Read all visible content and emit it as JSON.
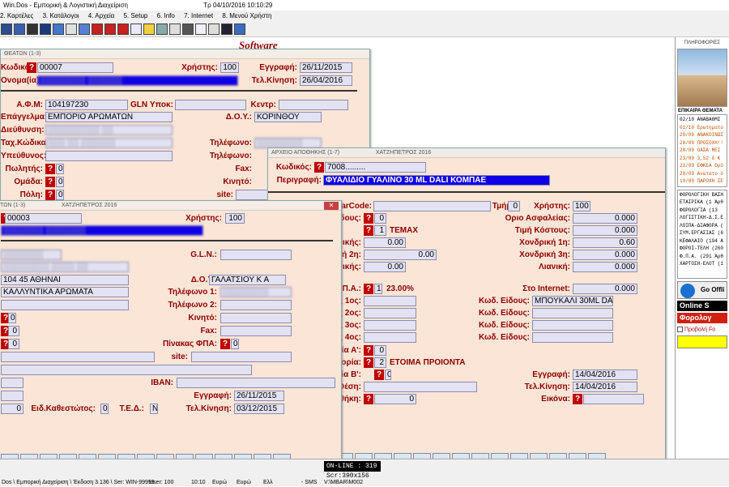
{
  "app": {
    "title": "Win.Dos - Εμπορική & Λογιστική Διαχείριση",
    "date": "Τρ 04/10/2016 10:10:29"
  },
  "menu": [
    "2. Καρτέλες",
    "3. Κατάλογοι",
    "4. Αρχεία",
    "5. Setup",
    "6. Info",
    "7. Internet",
    "8. Μενού Χρήστη"
  ],
  "brand": "Software",
  "w1": {
    "title": "ΘΕΑΤΩΝ (1-3)",
    "kod_lbl": "Κωδικός:",
    "kod": "00007",
    "xrhsths_lbl": "Χρήστης:",
    "xrhsths": "100",
    "eggrafh_lbl": "Εγγραφή:",
    "eggrafh": "26/11/2015",
    "onoma_lbl": "Ονομα(ία):",
    "telkin_lbl": "Τελ.Κίνηση:",
    "telkin": "26/04/2016",
    "afm_lbl": "Α.Φ.Μ:",
    "afm": "104197230",
    "gln_lbl": "GLN Υποκ:",
    "kentr_lbl": "Κεντρ:",
    "epag_lbl": "Επάγγελμα:",
    "epag": "ΕΜΠΟΡΙΟ ΑΡΩΜΑΤΩΝ",
    "doy_lbl": "Δ.Ο.Υ.:",
    "doy": "ΚΟΡΙΝΘΟΥ",
    "dieu_lbl": "Διεύθυνση:",
    "tk_lbl": "Ταχ.Κώδικας:",
    "til_lbl": "Τηλέφωνο:",
    "ypeu_lbl": "Υπεύθυνος:",
    "til2_lbl": "Τηλέφωνο:",
    "pol_lbl": "Πωλητής:",
    "pol": "0",
    "fax_lbl": "Fax:",
    "omada_lbl": "Ομάδα:",
    "omada": "0",
    "kin_lbl": "Κινητό:",
    "poli_lbl": "Πόλη:",
    "poli": "0",
    "site_lbl": "site:"
  },
  "w2": {
    "title": "ΤΩΝ (1-3)",
    "title2": "ΧΑΤΖΗΠΕΤΡΟΣ 2016",
    "kod": "00003",
    "xrhsths_lbl": "Χρήστης:",
    "xrhsths": "100",
    "gln_lbl": "G.L.N.:",
    "afm": "104 45  ΑΘΗΝΑΙ",
    "doy_lbl": "Δ.Ο.Υ.:",
    "doy": "ΓΑΛΑΤΣΙΟΥ Κ Α",
    "epag": "ΚΑΛΛΥΝΤΙΚΑ ΑΡΩΜΑΤΑ",
    "til1_lbl": "Τηλέφωνο 1:",
    "til2_lbl": "Τηλέφωνο 2:",
    "kin_lbl": "Κινητό:",
    "v0a": "0",
    "v0b": "0",
    "fax_lbl": "Fax:",
    "v0c": "0",
    "fpa_lbl": "Πίνακας ΦΠΑ:",
    "fpa": "0",
    "site_lbl": "site:",
    "iban_lbl": "IBAN:",
    "eggrafh_lbl": "Εγγραφή:",
    "eggrafh": "26/11/2015",
    "eidk_lbl": "Ειδ.Καθεστώτος:",
    "eidk": "0",
    "ted_lbl": "Τ.Ε.Δ.:",
    "ted": "N",
    "telkin_lbl": "Τελ.Κίνηση:",
    "telkin": "03/12/2015",
    "v0d": "0"
  },
  "w3": {
    "title": "ΑΡΧΕΙΟ ΑΠΟΘΗΚΗΣ   (1-7)",
    "title2": "ΧΑΤΖΗΠΕΤΡΟΣ 2016",
    "kod_lbl": "Κωδικός:",
    "kod": "7008.........",
    "perig_lbl": "Περιγραφή:",
    "perig": "ΦΥΑΛΙΔΙΟ ΓΥΑΛΙΝΟ 30 ML DALI  ΚΟΜΠΑΕ",
    "barcode_lbl": "BarCode:",
    "tmhma_lbl": "Τμήμα:",
    "tmhma": "0",
    "xrhsths_lbl": "Χρήστης:",
    "xrhsths": "100",
    "eidous_lbl": "ίδους:",
    "eidous": "0",
    "orio_lbl": "Οριο Ασφαλείας:",
    "orio": "0.000",
    "mon_val": "1",
    "mon": "TEMAX",
    "timi_lbl": "Τιμή Κόστους:",
    "timi": "0.000",
    "xondr_lbl": "ονδρικής:",
    "xondr": "0.00",
    "x1_lbl": "Χονδρική 1η:",
    "x1": "0.60",
    "x2_lbl": "δρική 2η:",
    "x2": "0.00",
    "x3_lbl": "Χονδρική 3η:",
    "x3": "0.000",
    "lian_lbl": "ιανικής:",
    "lian": "0.00",
    "lianiki_lbl": "Λιανική:",
    "lianiki": "0.000",
    "fpa_lbl": "Π.Α.:",
    "fpa_val": "1",
    "fpa_pct": "23.00%",
    "internet_lbl": "Στο Internet:",
    "internet": "0.000",
    "e1_lbl": "Κωδ. Είδους:",
    "e1": "ΜΠΟΥΚΑΛΙ 30ML DALI",
    "e2_lbl": "Κωδ. Είδους:",
    "e3_lbl": "Κωδ. Είδους:",
    "e4_lbl": "Κωδ. Είδους:",
    "c1_lbl": "ς 1ος:",
    "c2_lbl": "ς 2ος:",
    "c3_lbl": "ς 3ος:",
    "c4_lbl": "ς 4ος:",
    "kA_lbl": "ία Α':",
    "kA": "0",
    "kat_lbl": "γορία:",
    "kat_val": "2",
    "kat": "ΕΤΟΙΜΑ ΠΡΟΙΟΝΤΑ",
    "kB_lbl": "ία Β':",
    "kB": "0",
    "eggrafh_lbl": "Εγγραφή:",
    "eggrafh": "14/04/2016",
    "thesi_lbl": "ική Θέση:",
    "telkin_lbl": "Τελ.Κίνηση:",
    "telkin": "14/04/2016",
    "apoth_lbl": "οθήκη:",
    "apoth": "0",
    "eikona_lbl": "Εικόνα:"
  },
  "side": {
    "title": "ΠΛΗΡΟΦΟΡΙΕΣ",
    "section": "ΕΠΙΚΑΙΡΑ ΘΕΜΑΤΑ",
    "news": [
      [
        "02/10 ΑΝΑΒΑΘΜΙ",
        "#000"
      ],
      [
        "01/10 Ερωτηματο",
        "#c05000"
      ],
      [
        "29/09 ΑΝΑΚΟΙΝΩΣ",
        "#c05000"
      ],
      [
        "28/09 ΠΡΟΣΟΧΗ!!",
        "#c05000"
      ],
      [
        "28/09 ΟΑΣΑ ΜΕΙ",
        "#c05000"
      ],
      [
        "23/09 3,52 δ €",
        "#c05000"
      ],
      [
        "23/09 ΕΦΚΕΑ Ορό",
        "#c05000"
      ],
      [
        "20/09 Ανώτατο ό",
        "#c05000"
      ],
      [
        "19/09 ΠΑΡΟΧΗ ΣΕ",
        "#c05000"
      ]
    ],
    "list": [
      "ΦΟΡΟΛΟΓΙΚΗ ΒΑΣΗ",
      "ΕΤΑΙΡΙΚΑ (1 Άρθ",
      "ΦΟΡΟΛΟΓΙΑ (13",
      "ΛΟΓΙΣΤΙΚΗ-Δ.Σ.Ε",
      "ΛΟΙΠΑ-ΔΙΑΦΟΡΑ (",
      "ΣΥΜ.ΕΡΓΑΣΙΑΣ (6",
      "ΚΕΦΑΛΑΙΟ (194 Α",
      "ΦΟΡΟΙ-ΤΕΛΗ (260",
      "Φ.Π.Α. (291 Άρθ",
      "ΧΑΡΤΟΣΗ-ΕΛΟΤ (1"
    ],
    "go": "Go Offli",
    "online": "Online S",
    "foro": "Φορολογ",
    "provoli": "Προβολή Fo"
  },
  "status": {
    "online": "ON-LINE : 319",
    "scr": "Scr:390x156",
    "path": "Dos \\ Εμπορική Διαχείριση \\ Έκδοση 3.136 \\ Ser: WIN-99999",
    "user": "User: 100",
    "time": "10:10",
    "cur1": "Ευρώ",
    "cur2": "Ευρώ",
    "ell": "Ελλ",
    "sms": "- SMS",
    "dir": "V:\\MBAR\\M002"
  }
}
